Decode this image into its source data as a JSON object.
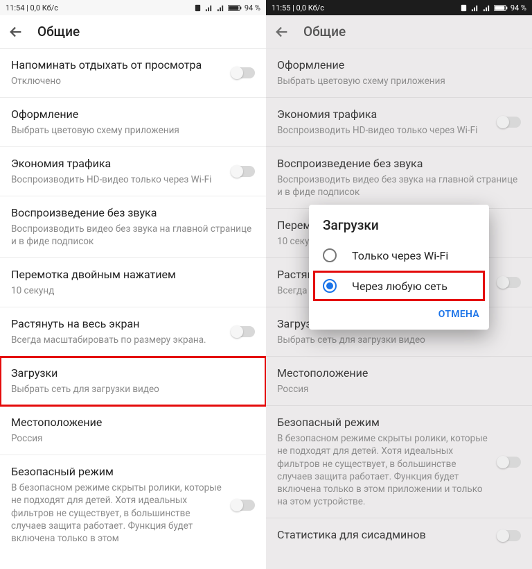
{
  "left": {
    "status": {
      "time": "11:54 | 0,0 Кб/с",
      "battery": "94"
    },
    "topbar_title": "Общие",
    "items": [
      {
        "title": "Напоминать отдыхать от просмотра",
        "sub": "Отключено",
        "toggle": true
      },
      {
        "title": "Оформление",
        "sub": "Выбрать цветовую схему приложения"
      },
      {
        "title": "Экономия трафика",
        "sub": "Воспроизводить HD-видео только через Wi-Fi",
        "toggle": true
      },
      {
        "title": "Воспроизведение без звука",
        "sub": "Воспроизводить видео без звука на главной странице и в фиде подписок"
      },
      {
        "title": "Перемотка двойным нажатием",
        "sub": "10 секунд"
      },
      {
        "title": "Растянуть на весь экран",
        "sub": "Всегда масштабировать по размеру экрана.",
        "toggle": true
      },
      {
        "title": "Загрузки",
        "sub": "Выбрать сеть для загрузки видео",
        "hl": true
      },
      {
        "title": "Местоположение",
        "sub": "Россия"
      },
      {
        "title": "Безопасный режим",
        "sub": "В безопасном режиме скрыты ролики, которые не подходят для детей. Хотя идеальных фильтров не существует, в большинстве случаев защита работает. Функция будет включена только в этом",
        "toggle": true
      }
    ]
  },
  "right": {
    "status": {
      "time": "11:55 | 0,0 Кб/с",
      "battery": "94"
    },
    "topbar_title": "Общие",
    "items": [
      {
        "title": "Оформление",
        "sub": "Выбрать цветовую схему приложения"
      },
      {
        "title": "Экономия трафика",
        "sub": "Воспроизводить HD-видео только через Wi-Fi",
        "toggle": true
      },
      {
        "title": "Воспроизведение без звука",
        "sub": "Воспроизводить видео без звука на главной странице и в фиде подписок"
      },
      {
        "title": "Перемотка двойным нажатием",
        "sub": "10 секунд"
      },
      {
        "title": "Растянуть на весь экран",
        "sub": "Всегда масштабировать по размеру экрана.",
        "toggle": true
      },
      {
        "title": "Загрузки",
        "sub": "Выбрать сеть для загрузки видео"
      },
      {
        "title": "Местоположение",
        "sub": "Россия"
      },
      {
        "title": "Безопасный режим",
        "sub": "В безопасном режиме скрыты ролики, которые не подходят для детей. Хотя идеальных фильтров не существует, в большинстве случаев защита работает. Функция будет включена только в этом приложении и только на этом устройстве.",
        "toggle": true
      },
      {
        "title": "Статистика для сисадминов",
        "toggle": true
      }
    ],
    "dialog": {
      "title": "Загрузки",
      "options": [
        {
          "label": "Только через Wi-Fi",
          "checked": false
        },
        {
          "label": "Через любую сеть",
          "checked": true,
          "hl": true
        }
      ],
      "cancel": "ОТМЕНА"
    }
  },
  "icons": {
    "clock": "⏰",
    "signal": "📶",
    "batt_suffix": " %"
  }
}
